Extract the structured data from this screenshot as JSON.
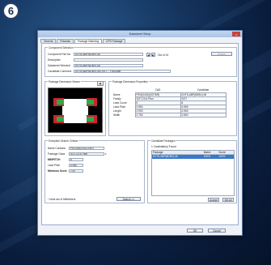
{
  "step": "6",
  "dialog": {
    "title": "Datasheet Setup",
    "close": "×",
    "tabs": [
      "General",
      "Fiducials",
      "Package Matching",
      "CPG Package"
    ],
    "component_selection": {
      "title": "Component Selection",
      "part_no_label": "Component Part No",
      "part_no_value": "DVT6-ABP(6DBV)-06",
      "description_label": "Description",
      "description_value": "",
      "datasheet_label": "Datasheet Selected",
      "datasheet_value": "DVT6-ABP(6DBV)-06",
      "candidate_label": "Candidate Comment",
      "candidate_value": "DVT6-ABP(6DBV)-06 (SOT-...) Not slbd",
      "counter": "Out of 24",
      "search_btn": "Search"
    },
    "viewer": {
      "title": "Package Dimension Viewer"
    },
    "properties": {
      "title": "Package Dimension Properties",
      "col_cad": "CAD",
      "col_candidate": "Candidate",
      "rows": [
        {
          "label": "Name",
          "cad": "PKG(0402)(SOT6R)",
          "cand": "DVT6-ABP(6DBV)-06"
        },
        {
          "label": "Family",
          "cad": "SOT-23-6 Pkor",
          "cand": "SOT"
        },
        {
          "label": "Lead Count",
          "cad": "6",
          "cand": "6"
        },
        {
          "label": "Lead Pitch",
          "cad": "0.950",
          "cand": "0.950"
        },
        {
          "label": "Length",
          "cad": "2.900",
          "cand": "2.900"
        },
        {
          "label": "Width",
          "cad": "2.750",
          "cand": "2.800"
        }
      ]
    },
    "exception": {
      "title": "Exception Search Criteria",
      "rows": [
        {
          "label": "Name Contains",
          "value": "PKG(0402)(SOT6R)"
        },
        {
          "label": "Package Class",
          "value": "SOT-23-6 Pkor"
        },
        {
          "label": "MINPITCH",
          "value": "6"
        },
        {
          "label": "Lead Pitch",
          "value": "0.950"
        },
        {
          "label": "Minimum Score",
          "value": "70.0"
        }
      ],
      "note": "* Units are in Millimeters",
      "search_btn": "Search >>"
    },
    "candidates": {
      "title": "Candidate Packages",
      "found": "1 Candidate(s) Found",
      "headers": [
        "Package",
        "Match",
        "Score"
      ],
      "rows": [
        {
          "package": "DVT6-ABP(6DBV)-06",
          "match": "100%",
          "score": "100%"
        }
      ],
      "accept_btn": "Accept",
      "setall_btn": "Set All"
    },
    "ok_btn": "OK",
    "cancel_btn": "Cancel"
  }
}
